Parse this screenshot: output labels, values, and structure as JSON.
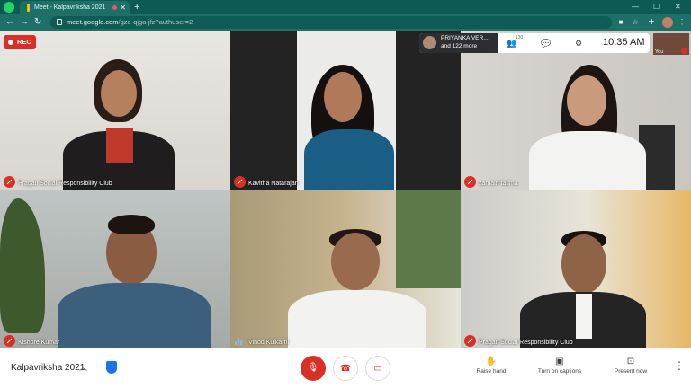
{
  "browser": {
    "tab_title": "Meet - Kalpavriksha 2021",
    "tab_close": "✕",
    "new_tab": "+",
    "minimize": "—",
    "maximize": "☐",
    "close": "✕",
    "back": "←",
    "forward": "→",
    "reload": "↻",
    "url_host": "meet.google.com",
    "url_path": "/gze-qjga-jfz?authuser=2"
  },
  "meet": {
    "rec_label": "REC",
    "pinned_name": "PRIYANKA VER...",
    "pinned_more": "and 122 more",
    "participant_count": "130",
    "clock": "10:35 AM",
    "self_label": "You",
    "tiles": [
      {
        "name": "Pragati Social Responsibility Club",
        "muted": true
      },
      {
        "name": "Kavitha Natarajan",
        "muted": true
      },
      {
        "name": "zamain fatima",
        "muted": true
      },
      {
        "name": "Kishore Kumar",
        "muted": true
      },
      {
        "name": "Vinod Kulkarni",
        "muted": false
      },
      {
        "name": "Pragati Social Responsibility Club",
        "muted": true
      }
    ]
  },
  "controls": {
    "meeting_title": "Kalpavriksha 2021",
    "raise_hand": "Raise hand",
    "captions": "Turn on captions",
    "present": "Present now"
  },
  "colors": {
    "chrome": "#1e6f67",
    "mute_red": "#d93025",
    "stage": "#202124"
  }
}
